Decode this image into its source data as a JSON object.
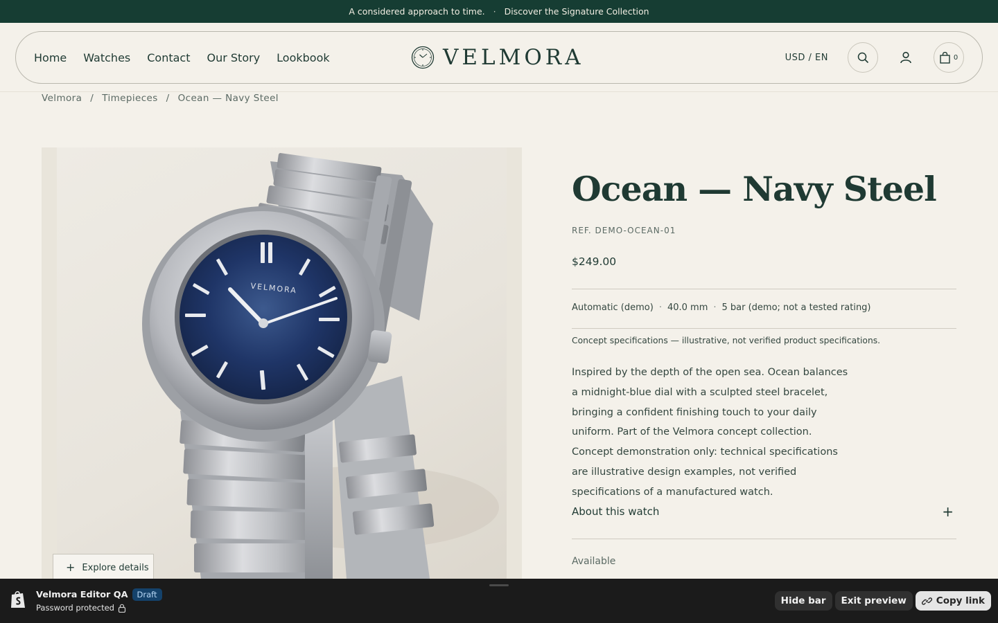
{
  "announcement": {
    "text": "A considered approach to time.",
    "separator": "·",
    "link": "Discover the Signature Collection"
  },
  "header": {
    "nav": [
      "Home",
      "Watches",
      "Contact",
      "Our Story",
      "Lookbook"
    ],
    "brand": "VELMORA",
    "locale": "USD / EN",
    "cart_count": "0",
    "icons": {
      "logo": "watch-face-icon",
      "search": "search-icon",
      "account": "user-icon",
      "cart": "shopping-bag-icon"
    }
  },
  "breadcrumb": {
    "items": [
      "Velmora",
      "Timepieces",
      "Ocean — Navy Steel"
    ],
    "separator": "/"
  },
  "gallery": {
    "dial_brand": "VELMORA",
    "explore_label": "Explore details"
  },
  "product": {
    "title": "Ocean — Navy Steel",
    "ref": "REF. DEMO-OCEAN-01",
    "price": "$249.00",
    "specs": [
      "Automatic (demo)",
      "40.0 mm",
      "5 bar (demo; not a tested rating)"
    ],
    "specs_separator": "·",
    "note": "Concept specifications — illustrative, not verified product specifications.",
    "description": "Inspired by the depth of the open sea. Ocean balances a midnight-blue dial with a sculpted steel bracelet, bringing a confident finishing touch to your daily uniform. Part of the Velmora concept collection. Concept demonstration only: technical specifications are illustrative design examples, not verified specifications of a manufactured watch.",
    "accordion_label": "About this watch",
    "availability": "Available"
  },
  "admin_bar": {
    "store_name": "Velmora Editor QA",
    "badge": "Draft",
    "subtitle": "Password protected",
    "buttons": {
      "hide": "Hide bar",
      "exit": "Exit preview",
      "copy": "Copy link"
    }
  },
  "colors": {
    "brand_green": "#163d33",
    "background": "#f4f1ea",
    "dial_navy": "#1b2f5c",
    "admin_bar": "#1b1b1b"
  }
}
